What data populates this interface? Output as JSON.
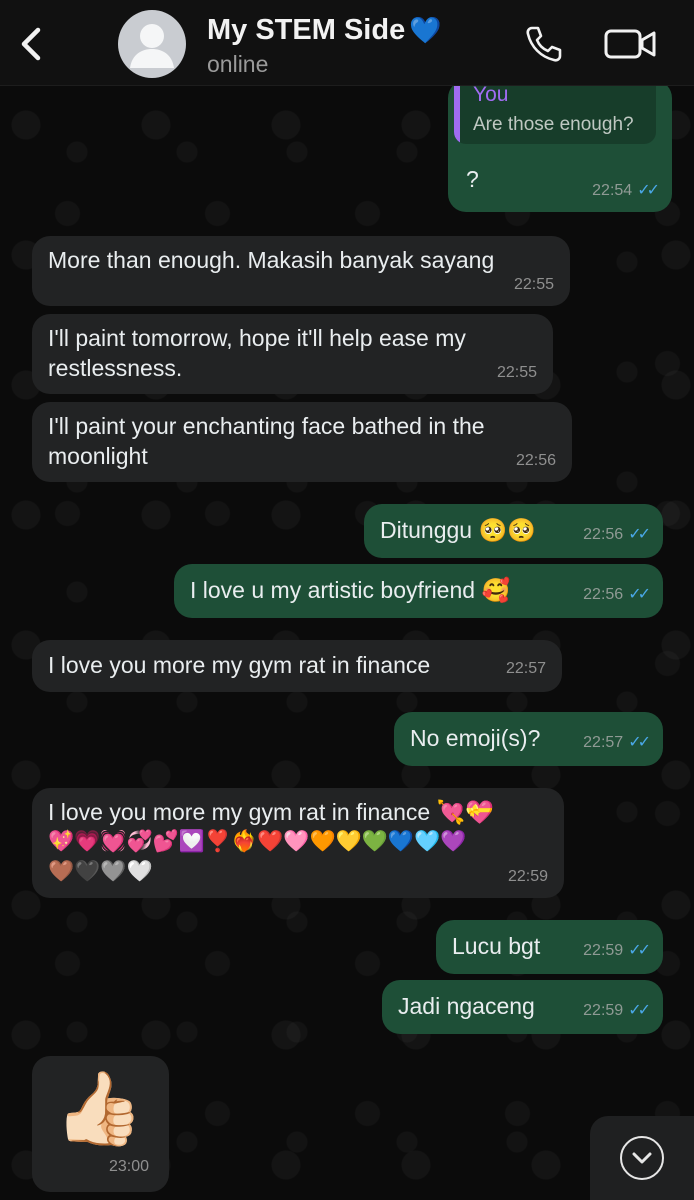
{
  "header": {
    "title": "My STEM Side",
    "title_emoji": "💙",
    "status": "online",
    "icons": [
      "back-chevron-icon",
      "avatar-placeholder-icon",
      "phone-icon",
      "video-camera-icon"
    ]
  },
  "quoted": {
    "author": "You",
    "text": "Are those enough?"
  },
  "messages": [
    {
      "dir": "out",
      "text": "?",
      "time": "22:54"
    },
    {
      "dir": "in",
      "text": "More than enough. Makasih banyak sayang",
      "time": "22:55"
    },
    {
      "dir": "in",
      "text": "I'll paint tomorrow, hope it'll help ease my restlessness.",
      "time": "22:55"
    },
    {
      "dir": "in",
      "text": "I'll paint your enchanting face bathed in the moonlight",
      "time": "22:56"
    },
    {
      "dir": "out",
      "text": "Ditunggu 🥺🥺",
      "time": "22:56"
    },
    {
      "dir": "out",
      "text": "I love u my artistic boyfriend 🥰",
      "time": "22:56"
    },
    {
      "dir": "in",
      "text": "I love you more my gym rat in finance",
      "time": "22:57"
    },
    {
      "dir": "out",
      "text": "No emoji(s)?",
      "time": "22:57"
    },
    {
      "dir": "in",
      "text": "I love you more my gym rat in finance 💘💝",
      "text2": "💖💗💓💞💕💟❣️❤️‍🔥❤️🩷🧡💛💚💙🩵💜",
      "text3": "🤎🖤🩶🤍",
      "time": "22:59"
    },
    {
      "dir": "out",
      "text": "Lucu bgt",
      "time": "22:59"
    },
    {
      "dir": "out",
      "text": "Jadi ngaceng",
      "time": "22:59"
    },
    {
      "dir": "in",
      "sticker": "👍🏻",
      "time": "23:00"
    }
  ],
  "scroll_button_icon": "chevron-down-circle-icon",
  "colors": {
    "incoming_bubble": "#222324",
    "outgoing_bubble": "#1e4f37",
    "read_ticks": "#4aa8e8",
    "quote_accent": "#a06cf2"
  }
}
